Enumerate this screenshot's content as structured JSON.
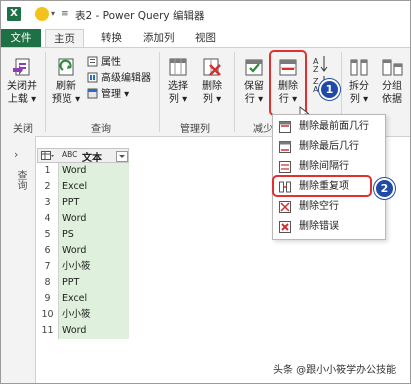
{
  "window": {
    "app_badge": "X",
    "quick_access_arrow": "▾",
    "quick_access_menu": "≡",
    "title": "表2 - Power Query 编辑器"
  },
  "tabs": [
    "文件",
    "主页",
    "转换",
    "添加列",
    "视图"
  ],
  "ribbon": {
    "close_upload": [
      "关闭并",
      "上载 ▾"
    ],
    "refresh_preview": [
      "刷新",
      "预览 ▾"
    ],
    "properties": "属性",
    "advanced_editor": "高级编辑器",
    "manage": "管理 ▾",
    "choose_columns": [
      "选择",
      "列 ▾"
    ],
    "delete_columns": [
      "删除",
      "列 ▾"
    ],
    "keep_rows": [
      "保留",
      "行 ▾"
    ],
    "delete_rows": [
      "删除",
      "行 ▾"
    ],
    "split_column": [
      "拆分",
      "列 ▾"
    ],
    "group_by": [
      "分组",
      "依据"
    ],
    "group_close": "关闭",
    "group_query": "查询",
    "group_manage_cols": "管理列",
    "group_reduce_partial": "减少"
  },
  "side_panel": {
    "expand_chevron": "›",
    "label": "查询"
  },
  "table": {
    "column_type": "ABC",
    "column_header": "文本",
    "rows": [
      {
        "n": "1",
        "v": "Word"
      },
      {
        "n": "2",
        "v": "Excel"
      },
      {
        "n": "3",
        "v": "PPT"
      },
      {
        "n": "4",
        "v": "Word"
      },
      {
        "n": "5",
        "v": "PS"
      },
      {
        "n": "6",
        "v": "Word"
      },
      {
        "n": "7",
        "v": "小小筱"
      },
      {
        "n": "8",
        "v": "PPT"
      },
      {
        "n": "9",
        "v": "Excel"
      },
      {
        "n": "10",
        "v": "小小筱"
      },
      {
        "n": "11",
        "v": "Word"
      }
    ]
  },
  "dropdown": {
    "items": [
      "删除最前面几行",
      "删除最后几行",
      "删除间隔行",
      "删除重复项",
      "删除空行",
      "删除错误"
    ]
  },
  "badges": [
    "1",
    "2"
  ],
  "watermark": "头条 @跟小小筱学办公技能",
  "colors": {
    "excel_green": "#1e7145",
    "highlight_red": "#e03030",
    "badge_blue": "#1f4aa8",
    "cell_green": "#dff0dc"
  }
}
